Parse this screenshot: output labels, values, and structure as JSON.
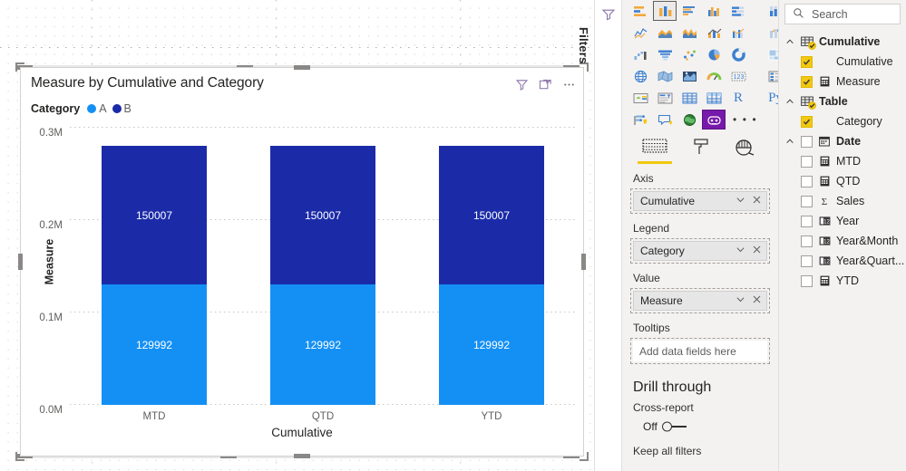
{
  "visual": {
    "title": "Measure by Cumulative and Category",
    "header_icons": [
      {
        "name": "filter-icon",
        "label": "Filters"
      },
      {
        "name": "focus-mode-icon",
        "label": "Focus mode"
      },
      {
        "name": "more-options-icon",
        "label": "More options"
      }
    ],
    "legend": {
      "title": "Category",
      "items": [
        {
          "label": "A",
          "color": "#1490F5"
        },
        {
          "label": "B",
          "color": "#1B2BA8"
        }
      ]
    }
  },
  "chart_data": {
    "type": "bar",
    "stacked": true,
    "title": "Measure by Cumulative and Category",
    "xlabel": "Cumulative",
    "ylabel": "Measure",
    "categories": [
      "MTD",
      "QTD",
      "YTD"
    ],
    "ylim": [
      0,
      300000
    ],
    "yticks": [
      0,
      100000,
      200000,
      300000
    ],
    "ytick_labels": [
      "0.0M",
      "0.1M",
      "0.2M",
      "0.3M"
    ],
    "grid": true,
    "legend_position": "top-left",
    "series": [
      {
        "name": "A",
        "color": "#1490F5",
        "values": [
          129992,
          129992,
          129992
        ],
        "labels": [
          "129992",
          "129992",
          "129992"
        ]
      },
      {
        "name": "B",
        "color": "#1B2BA8",
        "values": [
          150007,
          150007,
          150007
        ],
        "labels": [
          "150007",
          "150007",
          "150007"
        ]
      }
    ]
  },
  "filters_pane": {
    "label": "Filters",
    "icon": "filter-icon"
  },
  "visualizations_pane": {
    "gallery": [
      {
        "name": "stacked-bar-chart-icon",
        "selected": false
      },
      {
        "name": "stacked-column-chart-icon",
        "selected": true
      },
      {
        "name": "clustered-bar-chart-icon",
        "selected": false
      },
      {
        "name": "clustered-column-chart-icon",
        "selected": false
      },
      {
        "name": "100-stacked-bar-chart-icon",
        "selected": false
      },
      {
        "name": "100-stacked-column-chart-icon",
        "selected": false
      },
      {
        "name": "line-chart-icon",
        "selected": false
      },
      {
        "name": "area-chart-icon",
        "selected": false
      },
      {
        "name": "stacked-area-chart-icon",
        "selected": false
      },
      {
        "name": "line-stacked-column-chart-icon",
        "selected": false
      },
      {
        "name": "line-clustered-column-chart-icon",
        "selected": false
      },
      {
        "name": "ribbon-chart-icon",
        "selected": false
      },
      {
        "name": "waterfall-chart-icon",
        "selected": false
      },
      {
        "name": "funnel-chart-icon",
        "selected": false
      },
      {
        "name": "scatter-chart-icon",
        "selected": false
      },
      {
        "name": "pie-chart-icon",
        "selected": false
      },
      {
        "name": "donut-chart-icon",
        "selected": false
      },
      {
        "name": "treemap-icon",
        "selected": false
      },
      {
        "name": "map-icon",
        "selected": false
      },
      {
        "name": "filled-map-icon",
        "selected": false
      },
      {
        "name": "shape-map-icon",
        "selected": false
      },
      {
        "name": "gauge-icon",
        "selected": false
      },
      {
        "name": "card-icon",
        "selected": false
      },
      {
        "name": "multi-row-card-icon",
        "selected": false
      },
      {
        "name": "kpi-icon",
        "selected": false
      },
      {
        "name": "slicer-icon",
        "selected": false
      },
      {
        "name": "table-icon",
        "selected": false
      },
      {
        "name": "matrix-icon",
        "selected": false
      },
      {
        "name": "r-script-visual-icon",
        "label": "R",
        "selected": false
      },
      {
        "name": "python-visual-icon",
        "label": "Py",
        "selected": false
      },
      {
        "name": "key-influencers-icon",
        "selected": false
      },
      {
        "name": "decomposition-tree-icon",
        "selected": false
      },
      {
        "name": "arcgis-maps-icon",
        "selected": false
      },
      {
        "name": "custom-visual-icon",
        "selected": true
      },
      {
        "name": "more-visuals-icon",
        "label": "...",
        "selected": false
      }
    ],
    "tabs": [
      {
        "name": "fields-tab",
        "icon": "fields-grid-icon",
        "active": true
      },
      {
        "name": "format-tab",
        "icon": "paint-roller-icon",
        "active": false
      },
      {
        "name": "analytics-tab",
        "icon": "magnifier-analytics-icon",
        "active": false
      }
    ],
    "wells": [
      {
        "label": "Axis",
        "value": "Cumulative",
        "empty": false
      },
      {
        "label": "Legend",
        "value": "Category",
        "empty": false
      },
      {
        "label": "Value",
        "value": "Measure",
        "empty": false
      },
      {
        "label": "Tooltips",
        "value": "Add data fields here",
        "empty": true
      }
    ],
    "drill_through": {
      "title": "Drill through",
      "cross_report_label": "Cross-report",
      "cross_report_state": "Off",
      "keep_all_filters_label": "Keep all filters"
    }
  },
  "fields_pane": {
    "search_placeholder": "Search",
    "search_value": "",
    "search_icon": "search-icon",
    "items": [
      {
        "label": "Cumulative",
        "level": "table",
        "expanded": true,
        "checked": true,
        "icon": "table-icon"
      },
      {
        "label": "Cumulative",
        "level": "field",
        "checked": true,
        "icon": null
      },
      {
        "label": "Measure",
        "level": "field",
        "checked": true,
        "icon": "measure-icon"
      },
      {
        "label": "Table",
        "level": "table",
        "expanded": true,
        "checked": true,
        "icon": "table-icon"
      },
      {
        "label": "Category",
        "level": "field",
        "checked": true,
        "icon": null
      },
      {
        "label": "Date",
        "level": "table",
        "expanded": true,
        "checked": false,
        "icon": "calendar-icon"
      },
      {
        "label": "MTD",
        "level": "field",
        "checked": false,
        "icon": "measure-icon"
      },
      {
        "label": "QTD",
        "level": "field",
        "checked": false,
        "icon": "measure-icon"
      },
      {
        "label": "Sales",
        "level": "field",
        "checked": false,
        "icon": "sigma-icon"
      },
      {
        "label": "Year",
        "level": "field",
        "checked": false,
        "icon": "hierarchy-icon"
      },
      {
        "label": "Year&Month",
        "level": "field",
        "checked": false,
        "icon": "hierarchy-icon"
      },
      {
        "label": "Year&Quart...",
        "level": "field",
        "checked": false,
        "icon": "hierarchy-icon"
      },
      {
        "label": "YTD",
        "level": "field",
        "checked": false,
        "icon": "measure-icon"
      }
    ]
  },
  "colors": {
    "accent_yellow": "#f2c811",
    "series_a": "#1490F5",
    "series_b": "#1B2BA8",
    "pane_background": "#f3f2f1",
    "canvas_background": "#ffffff"
  }
}
